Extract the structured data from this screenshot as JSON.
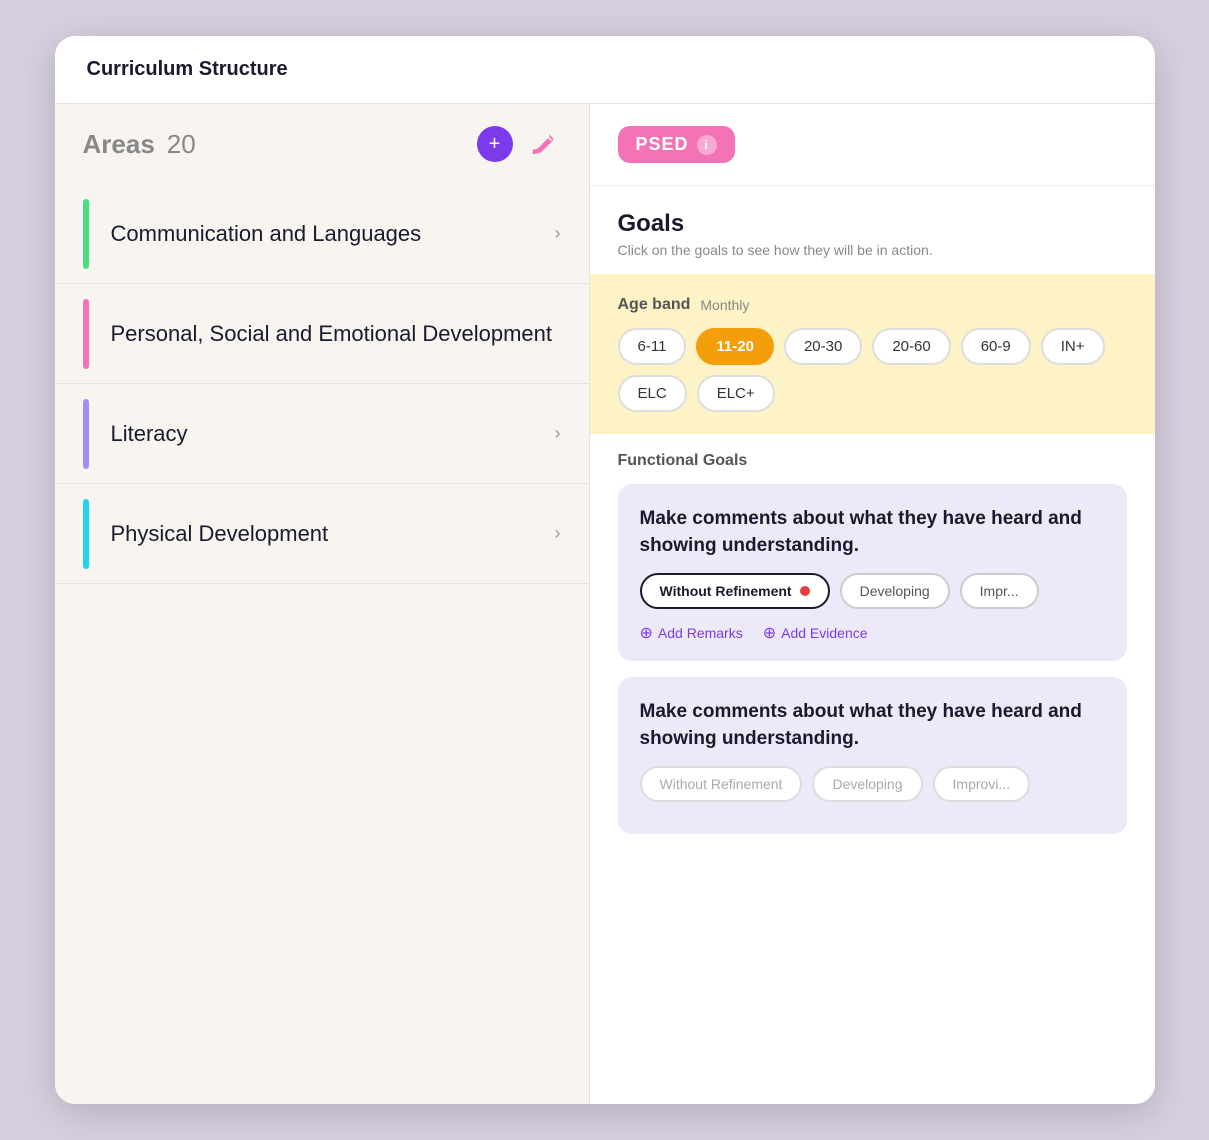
{
  "titleBar": {
    "title": "Curriculum Structure"
  },
  "leftPanel": {
    "areasLabel": "Areas",
    "areasCount": "20",
    "addIcon": "+",
    "editIconLabel": "edit"
  },
  "areas": [
    {
      "label": "Communication and Languages",
      "accentColor": "#4ade80",
      "hasChevron": true
    },
    {
      "label": "Personal, Social and Emotional Development",
      "accentColor": "#f472b6",
      "hasChevron": false
    },
    {
      "label": "Literacy",
      "accentColor": "#a78bfa",
      "hasChevron": true
    },
    {
      "label": "Physical Development",
      "accentColor": "#22d3ee",
      "hasChevron": true
    }
  ],
  "rightPanel": {
    "psedTag": "PSED",
    "infoIconLabel": "i",
    "goalsTitle": "Goals",
    "goalsSubtitle": "Click on the goals to see how they will be in action.",
    "ageBandLabel": "Age band",
    "ageBandFrequency": "Monthly",
    "ageBandChips": [
      {
        "label": "6-11",
        "active": false
      },
      {
        "label": "11-20",
        "active": true
      },
      {
        "label": "20-30",
        "active": false
      },
      {
        "label": "20-60",
        "active": false
      },
      {
        "label": "60-9",
        "active": false
      },
      {
        "label": "IN+",
        "active": false
      },
      {
        "label": "ELC",
        "active": false
      },
      {
        "label": "ELC+",
        "active": false
      }
    ],
    "functionalGoalsLabel": "Functional Goals",
    "goalCards": [
      {
        "text": "Make comments about what they have heard and showing understanding.",
        "chips": [
          {
            "label": "Without Refinement",
            "active": true,
            "hasDot": true
          },
          {
            "label": "Developing",
            "active": false
          },
          {
            "label": "Impr...",
            "active": false
          }
        ],
        "actions": [
          {
            "label": "Add Remarks"
          },
          {
            "label": "Add Evidence"
          }
        ]
      },
      {
        "text": "Make comments about what they have heard and showing understanding.",
        "chips": [
          {
            "label": "Without Refinement",
            "active": false,
            "hasDot": false
          },
          {
            "label": "Developing",
            "active": false
          },
          {
            "label": "Improvi...",
            "active": false
          }
        ],
        "actions": []
      }
    ]
  }
}
